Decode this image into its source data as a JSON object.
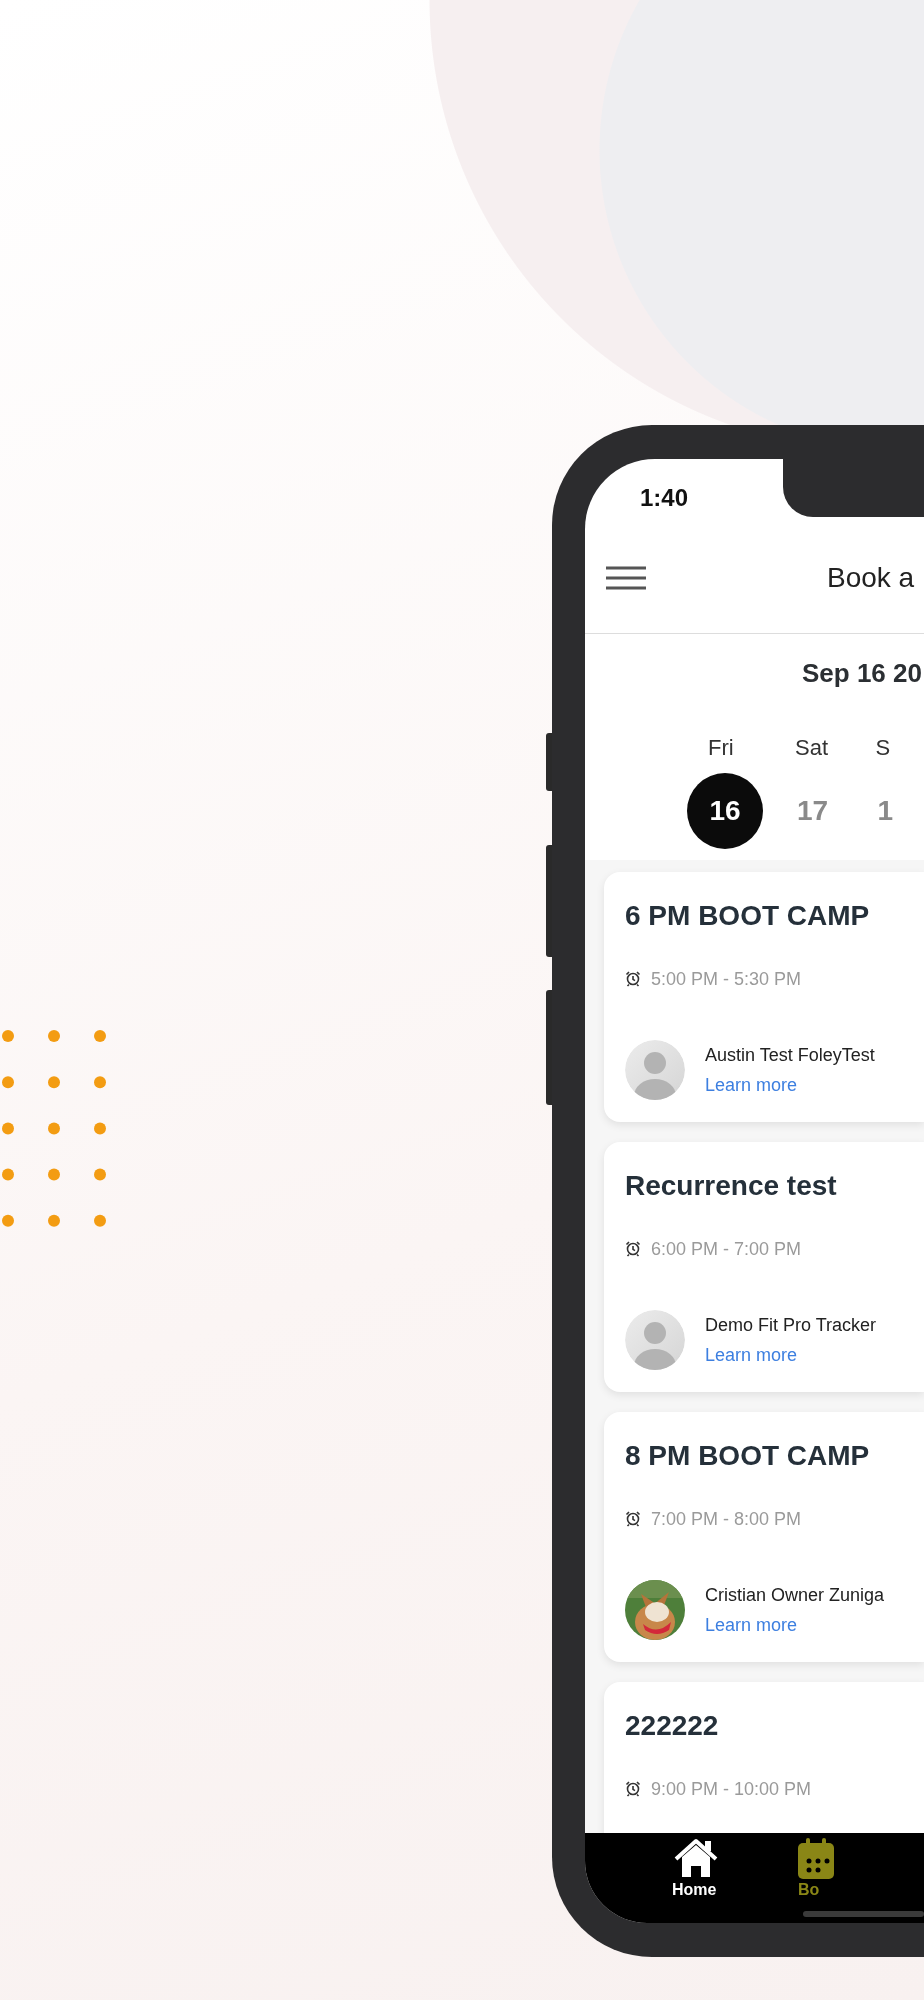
{
  "status_bar": {
    "time": "1:40"
  },
  "header": {
    "title": "Book a"
  },
  "date": "Sep 16 20",
  "days": [
    {
      "weekday": "Fri",
      "day": "16",
      "selected": true
    },
    {
      "weekday": "Sat",
      "day": "17",
      "selected": false
    },
    {
      "weekday": "S",
      "day": "1",
      "selected": false
    }
  ],
  "classes": [
    {
      "title": "6 PM BOOT CAMP",
      "time": "5:00 PM - 5:30 PM",
      "instructor": {
        "name": "Austin Test FoleyTest"
      },
      "link": "Learn more"
    },
    {
      "title": "Recurrence test",
      "time": "6:00 PM - 7:00 PM",
      "instructor": {
        "name": "Demo Fit Pro Tracker"
      },
      "link": "Learn more"
    },
    {
      "title": "8 PM BOOT CAMP",
      "time": "7:00 PM - 8:00 PM",
      "instructor": {
        "name": "Cristian Owner Zuniga"
      },
      "link": "Learn more"
    },
    {
      "title": "222222",
      "time": "9:00 PM - 10:00 PM"
    }
  ],
  "tab_bar": [
    {
      "label": "Home",
      "selected": false
    },
    {
      "label": "Bo",
      "selected": true
    }
  ]
}
